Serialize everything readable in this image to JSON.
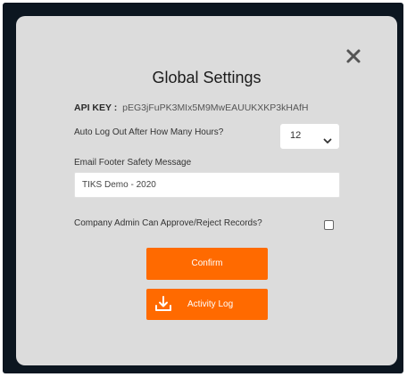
{
  "dialog": {
    "title": "Global Settings",
    "close_icon": "close-icon",
    "api_key": {
      "label": "API KEY :",
      "value": "pEG3jFuPK3MIx5M9MwEAUUKXKP3kHAfH"
    },
    "auto_logout": {
      "label": "Auto Log Out After How Many Hours?",
      "selected": "12",
      "icon": "chevron-down-icon"
    },
    "email_footer": {
      "label": "Email Footer Safety Message",
      "value": "TIKS Demo - 2020"
    },
    "company_admin_approve": {
      "label": "Company Admin Can Approve/Reject Records?",
      "checked": false
    },
    "confirm_button": "Confirm",
    "activity_log_button": {
      "label": "Activity Log",
      "icon": "download-icon"
    }
  },
  "colors": {
    "backdrop": "#0c1620",
    "modal_background": "#dcdcdc",
    "accent": "#ff6a00"
  }
}
